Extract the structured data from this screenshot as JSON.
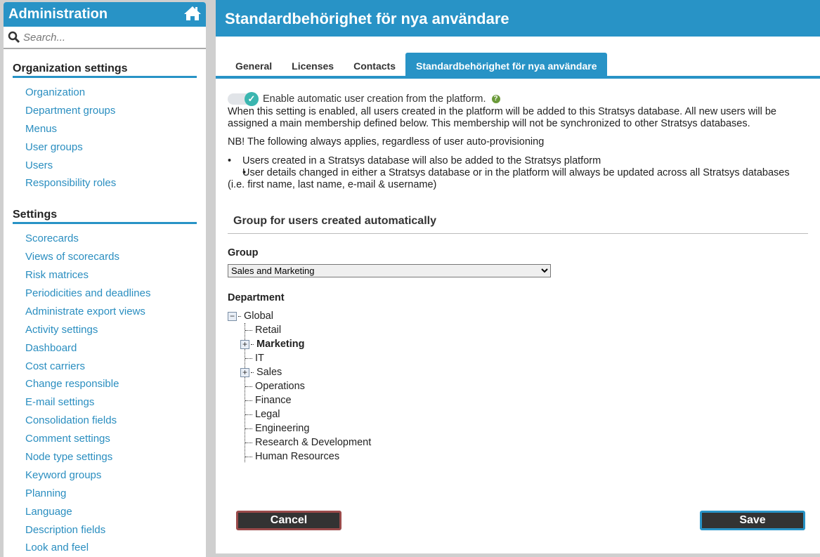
{
  "sidebar": {
    "title": "Administration",
    "search_placeholder": "Search...",
    "sections": [
      {
        "title": "Organization settings",
        "items": [
          "Organization",
          "Department groups",
          "Menus",
          "User groups",
          "Users",
          "Responsibility roles"
        ]
      },
      {
        "title": "Settings",
        "items": [
          "Scorecards",
          "Views of scorecards",
          "Risk matrices",
          "Periodicities and deadlines",
          "Administrate export views",
          "Activity settings",
          "Dashboard",
          "Cost carriers",
          "Change responsible",
          "E-mail settings",
          "Consolidation fields",
          "Comment settings",
          "Node type settings",
          "Keyword groups",
          "Planning",
          "Language",
          "Description fields",
          "Look and feel"
        ]
      }
    ]
  },
  "main": {
    "title": "Standardbehörighet för nya användare",
    "tabs": [
      "General",
      "Licenses",
      "Contacts",
      "Standardbehörighet för nya användare"
    ],
    "toggle_label": "Enable automatic user creation from the platform.",
    "description": "When this setting is enabled, all users created in the platform will be added to this Stratsys database. All new users will be assigned a main membership defined below. This membership will not be synchronized to other Stratsys databases.",
    "nb": "NB! The following always applies, regardless of user auto-provisioning",
    "bullets": [
      "Users created in a Stratsys database will also be added to the Stratsys platform",
      "User details changed in either a Stratsys database or in the platform will always be updated across all Stratsys databases (i.e. first name, last name, e-mail & username)"
    ],
    "group_section": "Group for users created automatically",
    "group_label": "Group",
    "group_value": "Sales and Marketing",
    "department_label": "Department",
    "tree": {
      "root": "Global",
      "children": [
        "Retail",
        "Marketing",
        "IT",
        "Sales",
        "Operations",
        "Finance",
        "Legal",
        "Engineering",
        "Research & Development",
        "Human Resources"
      ]
    },
    "cancel": "Cancel",
    "save": "Save"
  }
}
